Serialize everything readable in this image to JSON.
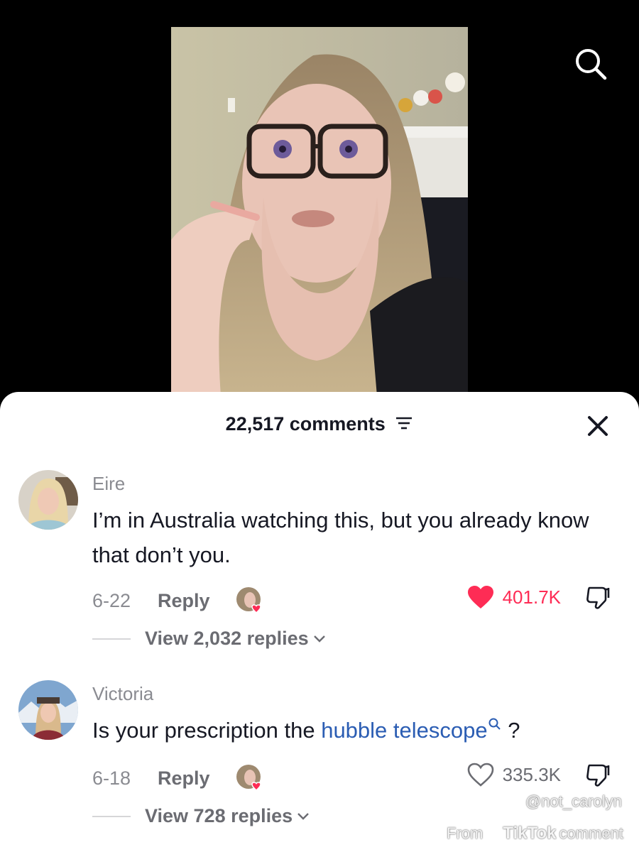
{
  "video": {
    "creator_watermark": "@not_carolyn"
  },
  "sheet": {
    "comment_count": "22,517 comments",
    "comments": [
      {
        "username": "Eire",
        "text": "I’m in Australia watching this, but you already know that don’t you.",
        "date": "6-22",
        "reply_label": "Reply",
        "likes": "401.7K",
        "liked": true,
        "view_replies": "View 2,032 replies"
      },
      {
        "username": "Victoria",
        "text_before": "Is your prescription the ",
        "text_link": "hubble telescope",
        "text_after": " ?",
        "date": "6-18",
        "reply_label": "Reply",
        "likes": "335.3K",
        "liked": false,
        "view_replies": "View 728 replies"
      }
    ]
  },
  "watermark": {
    "from": "From",
    "brand": "TikTok",
    "suffix": "comment"
  },
  "colors": {
    "like_red": "#fe2c55",
    "link_blue": "#2b5db3"
  },
  "icons": [
    "search-icon",
    "filter-icon",
    "close-icon",
    "heart-icon",
    "dislike-icon",
    "chevron-down-icon"
  ]
}
